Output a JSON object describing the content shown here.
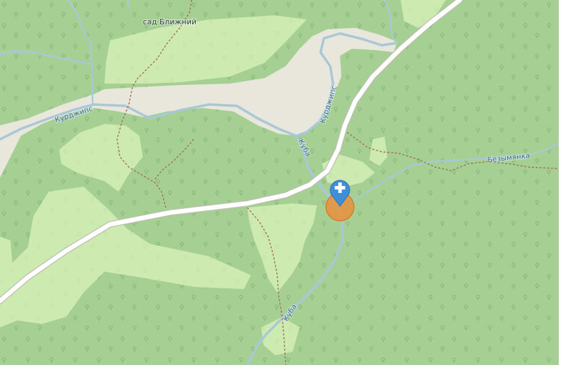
{
  "map": {
    "colors": {
      "forest": "#a6cf94",
      "meadow": "#cdeab0",
      "riverbed": "#e9e6dc",
      "river": "#a8c8d8",
      "road": "#ffffff",
      "road_casing": "#bdbdb0",
      "path": "#a0714f",
      "marker_blue": "#3f8fd8",
      "marker_orange": "#e8903c"
    },
    "labels": {
      "settlement": "сад Ближний",
      "river_kurdzhips_west": "Курджипс",
      "river_kurdzhips_east": "Курджипс",
      "river_kuba_north": "Куба",
      "river_kuba_south": "Куба",
      "stream_bezymyanka": "Безымянка"
    },
    "markers": {
      "pin_icon": "plus-pin-icon",
      "circle_icon": "orange-circle-icon"
    }
  }
}
